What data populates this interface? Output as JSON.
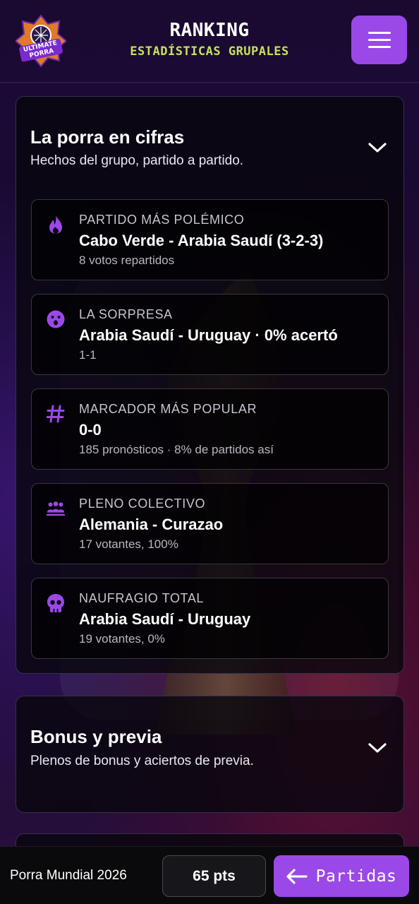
{
  "header": {
    "title": "RANKING",
    "subtitle": "ESTADÍSTICAS GRUPALES",
    "logo_text": "ULTIMATE PORRA",
    "menu_icon": "hamburger-icon"
  },
  "sections": {
    "cifras": {
      "title": "La porra en cifras",
      "description": "Hechos del grupo, partido a partido.",
      "cards": [
        {
          "icon": "flame-icon",
          "label": "PARTIDO MÁS POLÉMICO",
          "value": "Cabo Verde - Arabia Saudí (3-2-3)",
          "detail": "8 votos repartidos"
        },
        {
          "icon": "surprised-face-icon",
          "label": "LA SORPRESA",
          "value": "Arabia Saudí - Uruguay · 0% acertó",
          "detail": "1-1"
        },
        {
          "icon": "hash-icon",
          "label": "MARCADOR MÁS POPULAR",
          "value": "0-0",
          "detail": "185 pronósticos · 8% de partidos así"
        },
        {
          "icon": "group-icon",
          "label": "PLENO COLECTIVO",
          "value": "Alemania - Curazao",
          "detail": "17 votantes, 100%"
        },
        {
          "icon": "skull-icon",
          "label": "NAUFRAGIO TOTAL",
          "value": "Arabia Saudí - Uruguay",
          "detail": "19 votantes, 0%"
        }
      ]
    },
    "bonus": {
      "title": "Bonus y previa",
      "description": "Plenos de bonus y aciertos de previa."
    }
  },
  "footer": {
    "group_name": "Porra Mundial 2026",
    "points": "65 pts",
    "partidas_label": "Partidas"
  },
  "colors": {
    "accent": "#9b48e8",
    "subtitle": "#c6e15a",
    "background": "#12081f"
  }
}
